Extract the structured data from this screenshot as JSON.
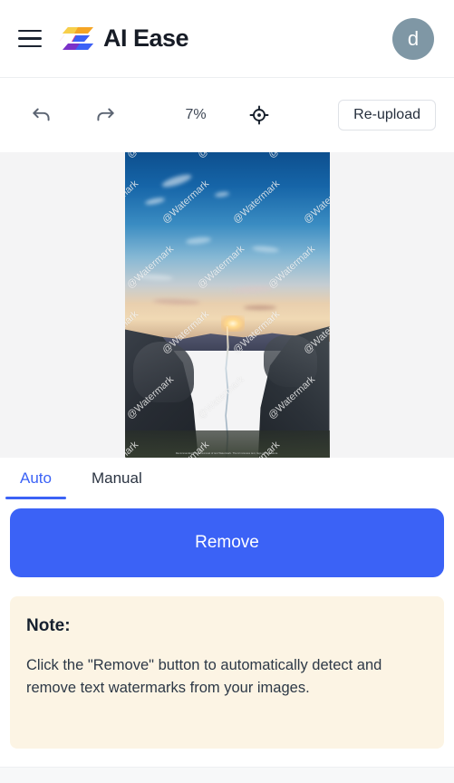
{
  "header": {
    "menu_icon": "hamburger-menu-icon",
    "logo_icon": "ai-ease-logo-icon",
    "brand_name": "AI Ease",
    "avatar_initial": "d"
  },
  "toolbar": {
    "undo_icon": "undo-arrow-icon",
    "redo_icon": "redo-arrow-icon",
    "zoom_level": "7%",
    "fit_icon": "crosshair-target-icon",
    "reupload_label": "Re-upload"
  },
  "canvas": {
    "image_alt": "canyon-river-sunset-photo",
    "watermark_text": "@Watermark",
    "photo_caption": "Recommended for the removal of text Watermark. The AI removes text, logo and signature."
  },
  "tabs": {
    "items": [
      {
        "label": "Auto",
        "active": true
      },
      {
        "label": "Manual",
        "active": false
      }
    ]
  },
  "action": {
    "remove_label": "Remove"
  },
  "note": {
    "title": "Note:",
    "body": "Click the \"Remove\" button to automatically detect and remove text watermarks  from your images."
  },
  "colors": {
    "accent_blue": "#3b62f6",
    "note_bg": "#fcf4e4",
    "canvas_bg": "#f4f4f5",
    "avatar_bg": "#7f97a5",
    "text_dark": "#16202e"
  }
}
